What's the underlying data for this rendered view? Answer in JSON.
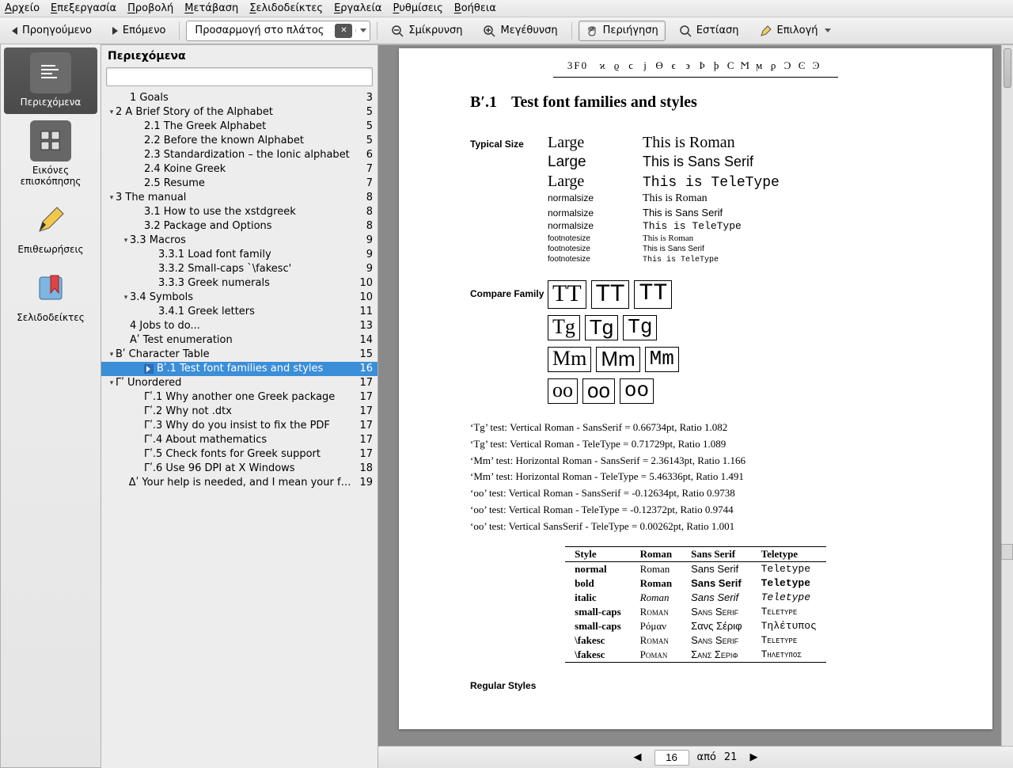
{
  "menubar": [
    "Αρχείο",
    "Επεξεργασία",
    "Προβολή",
    "Μετάβαση",
    "Σελιδοδείκτες",
    "Εργαλεία",
    "Ρυθμίσεις",
    "Βοήθεια"
  ],
  "toolbar": {
    "prev": "Προηγούμενο",
    "next": "Επόμενο",
    "fit_mode": "Προσαρμογή στο πλάτος",
    "zoom_out": "Σμίκρυνση",
    "zoom_in": "Μεγέθυνση",
    "browse": "Περιήγηση",
    "focus": "Εστίαση",
    "select": "Επιλογή"
  },
  "sidebar": {
    "items": [
      {
        "label": "Περιεχόμενα"
      },
      {
        "label": "Εικόνες επισκόπησης"
      },
      {
        "label": "Επιθεωρήσεις"
      },
      {
        "label": "Σελιδοδείκτες"
      }
    ]
  },
  "toc": {
    "title": "Περιεχόμενα",
    "entries": [
      {
        "indent": 1,
        "tw": "",
        "label": "1 Goals",
        "page": "3"
      },
      {
        "indent": 0,
        "tw": "▾",
        "label": "2 A Brief Story of the Alphabet",
        "page": "5"
      },
      {
        "indent": 2,
        "tw": "",
        "label": "2.1 The Greek Alphabet",
        "page": "5"
      },
      {
        "indent": 2,
        "tw": "",
        "label": "2.2 Before the known Alphabet",
        "page": "5"
      },
      {
        "indent": 2,
        "tw": "",
        "label": "2.3 Standardization – the Ionic alphabet",
        "page": "6"
      },
      {
        "indent": 2,
        "tw": "",
        "label": "2.4 Koine Greek",
        "page": "7"
      },
      {
        "indent": 2,
        "tw": "",
        "label": "2.5 Resume",
        "page": "7"
      },
      {
        "indent": 0,
        "tw": "▾",
        "label": "3 The manual",
        "page": "8"
      },
      {
        "indent": 2,
        "tw": "",
        "label": "3.1 How to use the xstdgreek",
        "page": "8"
      },
      {
        "indent": 2,
        "tw": "",
        "label": "3.2 Package and Options",
        "page": "8"
      },
      {
        "indent": 1,
        "tw": "▾",
        "label": "3.3 Macros",
        "page": "9"
      },
      {
        "indent": 3,
        "tw": "",
        "label": "3.3.1 Load font family",
        "page": "9"
      },
      {
        "indent": 3,
        "tw": "",
        "label": "3.3.2 Small-caps `\\fakesc'",
        "page": "9"
      },
      {
        "indent": 3,
        "tw": "",
        "label": "3.3.3 Greek numerals",
        "page": "10"
      },
      {
        "indent": 1,
        "tw": "▾",
        "label": "3.4 Symbols",
        "page": "10"
      },
      {
        "indent": 3,
        "tw": "",
        "label": "3.4.1 Greek letters",
        "page": "11"
      },
      {
        "indent": 1,
        "tw": "",
        "label": "4 Jobs to do...",
        "page": "13"
      },
      {
        "indent": 1,
        "tw": "",
        "label": "Αʹ Test enumeration",
        "page": "14"
      },
      {
        "indent": 0,
        "tw": "▾",
        "label": "Βʹ Character Table",
        "page": "15"
      },
      {
        "indent": 2,
        "tw": "",
        "label": "Βʹ.1 Test font families and styles",
        "page": "16",
        "selected": true,
        "play": true
      },
      {
        "indent": 0,
        "tw": "▾",
        "label": "Γʹ Unordered",
        "page": "17"
      },
      {
        "indent": 2,
        "tw": "",
        "label": "Γʹ.1 Why another one Greek package",
        "page": "17"
      },
      {
        "indent": 2,
        "tw": "",
        "label": "Γʹ.2 Why not .dtx",
        "page": "17"
      },
      {
        "indent": 2,
        "tw": "",
        "label": "Γʹ.3 Why do you insist to fix the PDF",
        "page": "17"
      },
      {
        "indent": 2,
        "tw": "",
        "label": "Γʹ.4 About mathematics",
        "page": "17"
      },
      {
        "indent": 2,
        "tw": "",
        "label": "Γʹ.5 Check fonts for Greek support",
        "page": "17"
      },
      {
        "indent": 2,
        "tw": "",
        "label": "Γʹ.6 Use 96 DPI at X Windows",
        "page": "18"
      },
      {
        "indent": 1,
        "tw": "",
        "label": "Δʹ Your help is needed, and I mean your feedback",
        "page": "19"
      }
    ]
  },
  "doc": {
    "codepoints_prefix": "3F0",
    "codepoints": [
      "ϰ",
      "ϱ",
      "ϲ",
      "ϳ",
      "ϴ",
      "ϵ",
      "϶",
      "Ϸ",
      "ϸ",
      "Ϲ",
      "Ϻ",
      "ϻ",
      "ϼ",
      "Ͻ",
      "Ͼ",
      "Ͽ"
    ],
    "section_num": "Βʹ.1",
    "section_title": "Test font families and styles",
    "typical_label": "Typical Size",
    "sizes": {
      "large": "Large",
      "normal": "normalsize",
      "footnote": "footnotesize"
    },
    "samples": {
      "roman": "This is Roman",
      "sans": "This is Sans Serif",
      "tt": "This is TeleType"
    },
    "compare_label": "Compare Family",
    "glyph_rows": [
      "TT",
      "Tg",
      "Mm",
      "oo"
    ],
    "tests": [
      "‘Tg’ test: Vertical Roman - SansSerif = 0.66734pt, Ratio 1.082",
      "‘Tg’ test: Vertical Roman - TeleType = 0.71729pt, Ratio 1.089",
      "‘Mm’ test: Horizontal Roman - SansSerif = 2.36143pt, Ratio 1.166",
      "‘Mm’ test: Horizontal Roman - TeleType = 5.46336pt, Ratio 1.491",
      "‘oo’ test: Vertical Roman - SansSerif = -0.12634pt, Ratio 0.9738",
      "‘oo’ test: Vertical Roman - TeleType = -0.12372pt, Ratio 0.9744",
      "‘oo’ test: Vertical SansSerif - TeleType = 0.00262pt, Ratio 1.001"
    ],
    "style_table": {
      "head": [
        "Style",
        "Roman",
        "Sans Serif",
        "Teletype"
      ],
      "rows": [
        {
          "style": "normal",
          "rm": "Roman",
          "ss": "Sans Serif",
          "tt": "Teletype",
          "b": false,
          "i": false,
          "sc": false
        },
        {
          "style": "bold",
          "rm": "Roman",
          "ss": "Sans Serif",
          "tt": "Teletype",
          "b": true,
          "i": false,
          "sc": false
        },
        {
          "style": "italic",
          "rm": "Roman",
          "ss": "Sans Serif",
          "tt": "Teletype",
          "b": false,
          "i": true,
          "sc": false
        },
        {
          "style": "small-caps",
          "rm": "Roman",
          "ss": "Sans Serif",
          "tt": "Teletype",
          "b": false,
          "i": false,
          "sc": true
        },
        {
          "style": "small-caps",
          "rm": "Ρόμαν",
          "ss": "Σανς Σέριφ",
          "tt": "Τηλέτυπος",
          "b": false,
          "i": false,
          "sc": false
        },
        {
          "style": "\\fakesc",
          "rm": "Roman",
          "ss": "Sans Serif",
          "tt": "Teletype",
          "b": false,
          "i": false,
          "sc": true
        },
        {
          "style": "\\fakesc",
          "rm": "Ροman",
          "ss": "Σανς Σεριφ",
          "tt": "Τηλετυπος",
          "b": false,
          "i": false,
          "sc": true
        }
      ]
    },
    "regular_styles": "Regular Styles"
  },
  "pagenav": {
    "current": "16",
    "of_label": "από",
    "total": "21"
  }
}
